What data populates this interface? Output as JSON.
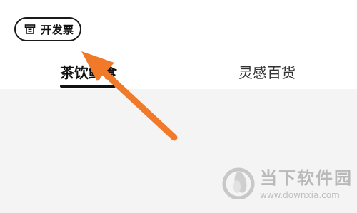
{
  "header": {
    "invoice_button_label": "开发票"
  },
  "tabs": [
    {
      "label": "茶饮鲜食",
      "active": true
    },
    {
      "label": "灵感百货",
      "active": false
    }
  ],
  "annotation": {
    "arrow_color": "#f07a2a"
  },
  "watermark": {
    "brand": "当下软件园",
    "url": "www.downxia.com"
  }
}
